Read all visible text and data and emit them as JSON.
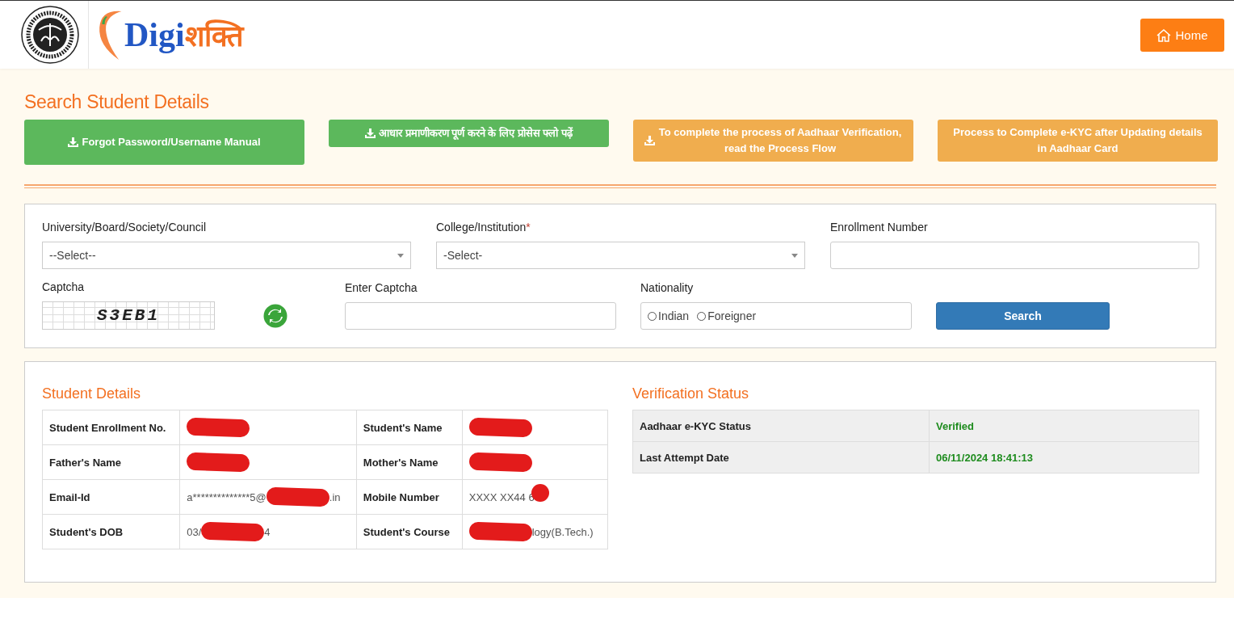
{
  "header": {
    "logo": {
      "latin": "Digi",
      "devanagari": "शक्ति"
    },
    "home_button": "Home"
  },
  "page_title": "Search Student Details",
  "action_buttons": [
    {
      "label": "Forgot Password/Username Manual",
      "color": "#5cb85c",
      "download_icon": true
    },
    {
      "label": "आधार प्रमाणीकरण पूर्ण करने के लिए प्रोसेस फ्लो पढ़ें",
      "color": "#5cb85c",
      "download_icon": true
    },
    {
      "label": "To complete the process of Aadhaar Verification, read the Process Flow",
      "color": "#f0ad4e",
      "download_icon": true
    },
    {
      "label": "Process to Complete e-KYC after Updating details in Aadhaar Card",
      "color": "#f0ad4e",
      "download_icon": false
    }
  ],
  "search_form": {
    "fields": [
      {
        "kind": "select",
        "label": "University/Board/Society/Council",
        "value": "--Select--"
      },
      {
        "kind": "select",
        "label": "College/Institution",
        "required_mark": "*",
        "value": "-Select-"
      },
      {
        "kind": "text",
        "label": "Enrollment Number"
      }
    ],
    "captcha": {
      "label": "Captcha",
      "text": "S3EB1"
    },
    "enter_captcha": {
      "label": "Enter Captcha"
    },
    "nationality": {
      "label": "Nationality",
      "options": [
        {
          "label": "Indian",
          "selected": false
        },
        {
          "label": "Foreigner",
          "selected": false
        }
      ]
    },
    "search_button": "Search"
  },
  "student_details": {
    "title": "Student Details",
    "rows": [
      [
        {
          "label": "Student Enrollment No.",
          "value": {
            "kind": "stroke",
            "redacted": true
          }
        },
        {
          "label": "Student's Name",
          "value": {
            "kind": "stroke",
            "redacted": true
          }
        }
      ],
      [
        {
          "label": "Father's Name",
          "value": {
            "kind": "stroke",
            "redacted": true
          }
        },
        {
          "label": "Mother's Name",
          "value": {
            "kind": "stroke",
            "redacted": true
          }
        }
      ],
      [
        {
          "label": "Email-Id",
          "value": {
            "before": "a**************5@",
            "kind": "stroke",
            "redacted": true,
            "after": ".in"
          }
        },
        {
          "label": "Mobile Number",
          "value": {
            "before": "XXXX XX44 6",
            "kind": "dot",
            "redacted": true
          }
        }
      ],
      [
        {
          "label": "Student's DOB",
          "value": {
            "before": "03/",
            "kind": "stroke",
            "redacted": true,
            "after": "4"
          }
        },
        {
          "label": "Student's Course",
          "value": {
            "kind": "stroke",
            "redacted": true,
            "after": "logy(B.Tech.)"
          }
        }
      ]
    ]
  },
  "verification_status": {
    "title": "Verification Status",
    "rows": [
      {
        "label": "Aadhaar e-KYC Status",
        "value": "Verified"
      },
      {
        "label": "Last Attempt Date",
        "value": "06/11/2024 18:41:13"
      }
    ]
  }
}
